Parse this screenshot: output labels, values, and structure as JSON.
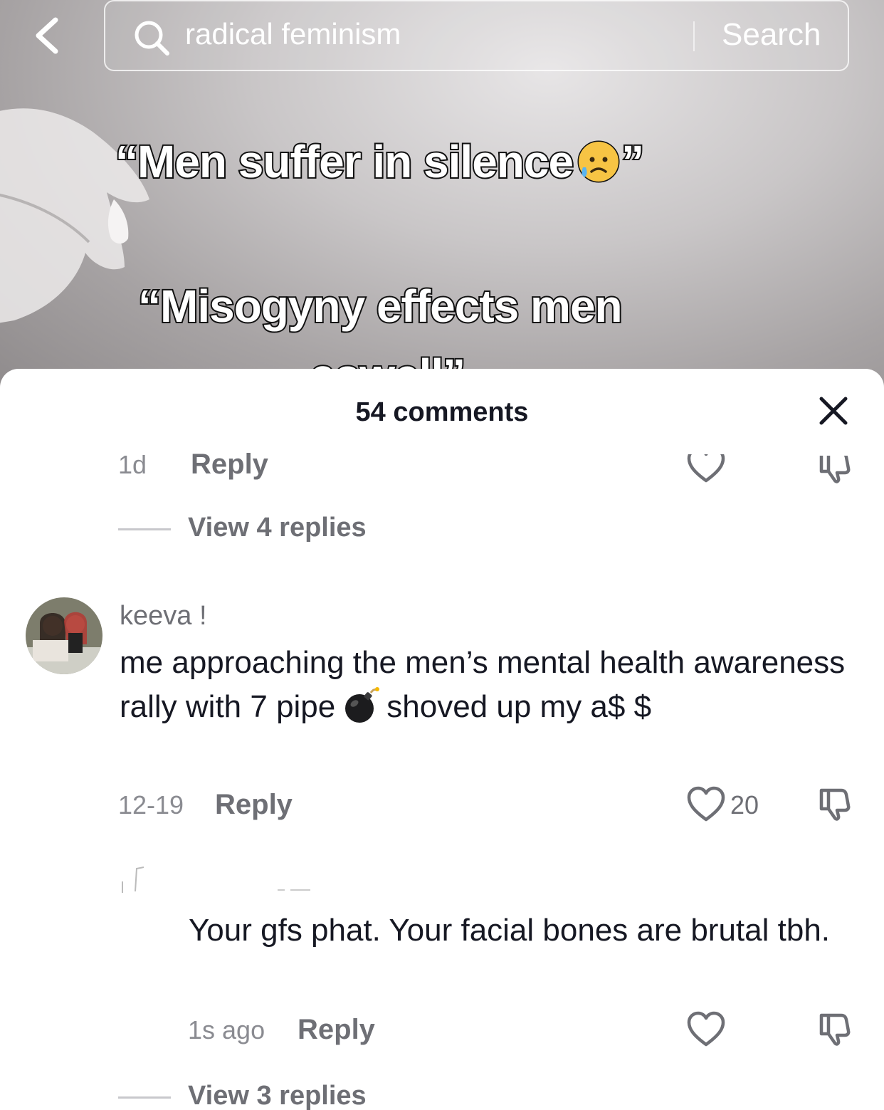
{
  "search": {
    "query": "radical feminism",
    "button_label": "Search"
  },
  "video": {
    "caption_line1": "“Men suffer in silence",
    "caption_line1_end": "”",
    "caption_line2": "“Misogyny effects men",
    "caption_line3": "aswell",
    "caption_line3_end": "”"
  },
  "comments_sheet": {
    "title": "54 comments",
    "previous_comment": {
      "time": "1d",
      "reply_label": "Reply",
      "view_replies_label": "View 4 replies"
    },
    "comment_keeva": {
      "username": "keeva  !",
      "text_before_emoji": "me approaching the men’s mental health awareness rally with 7 pipe",
      "text_after_emoji": "shoved up my a$ $",
      "time": "12-19",
      "reply_label": "Reply",
      "like_count": "20"
    },
    "reply_comment": {
      "text": "Your gfs phat. Your facial bones are brutal tbh.",
      "time": "1s ago",
      "reply_label": "Reply",
      "view_replies_label": "View 3 replies"
    }
  },
  "colors": {
    "sheet_bg": "#ffffff",
    "secondary_text": "#8a8b91",
    "action_text": "#6e6f75"
  }
}
